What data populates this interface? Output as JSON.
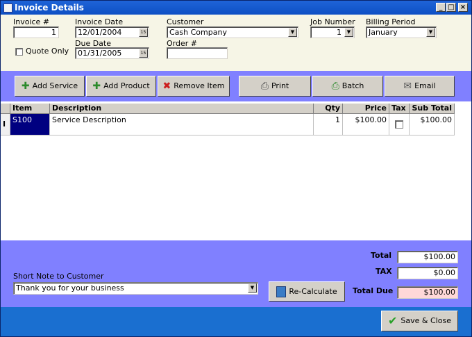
{
  "window": {
    "title": "Invoice Details",
    "minimize": "_",
    "maximize": "□",
    "close": "×"
  },
  "header": {
    "invoice_label": "Invoice #",
    "invoice_value": "1",
    "invoice_date_label": "Invoice Date",
    "invoice_date_value": "12/01/2004",
    "customer_label": "Customer",
    "customer_value": "Cash Company",
    "job_number_label": "Job Number",
    "job_number_value": "1",
    "billing_period_label": "Billing Period",
    "billing_period_value": "January",
    "quote_only_label": "Quote Only",
    "quote_only_checked": false,
    "due_date_label": "Due Date",
    "due_date_value": "01/31/2005",
    "order_label": "Order #",
    "order_value": ""
  },
  "toolbar": {
    "add_service": "Add Service",
    "add_product": "Add Product",
    "remove_item": "Remove Item",
    "print": "Print",
    "batch": "Batch",
    "email": "Email"
  },
  "grid": {
    "columns": [
      "Item",
      "Description",
      "Qty",
      "Price",
      "Tax",
      "Sub Total"
    ],
    "rows": [
      {
        "item": "S100",
        "description": "Service Description",
        "qty": "1",
        "price": "$100.00",
        "tax": false,
        "subtotal": "$100.00"
      }
    ],
    "row_indicator": "I"
  },
  "bottom": {
    "note_label": "Short Note to Customer",
    "note_value": "Thank you for your business",
    "recalculate": "Re-Calculate",
    "total_label": "Total",
    "total_value": "$100.00",
    "tax_label": "TAX",
    "tax_value": "$0.00",
    "total_due_label": "Total Due",
    "total_due_value": "$100.00"
  },
  "footer": {
    "save_close": "Save & Close"
  },
  "colors": {
    "accent": "#8080ff",
    "title_bar": "#0d4fc4",
    "header_bg": "#f6f5e6",
    "selected_cell": "#000080",
    "total_due_bg": "#ffd8d8"
  }
}
